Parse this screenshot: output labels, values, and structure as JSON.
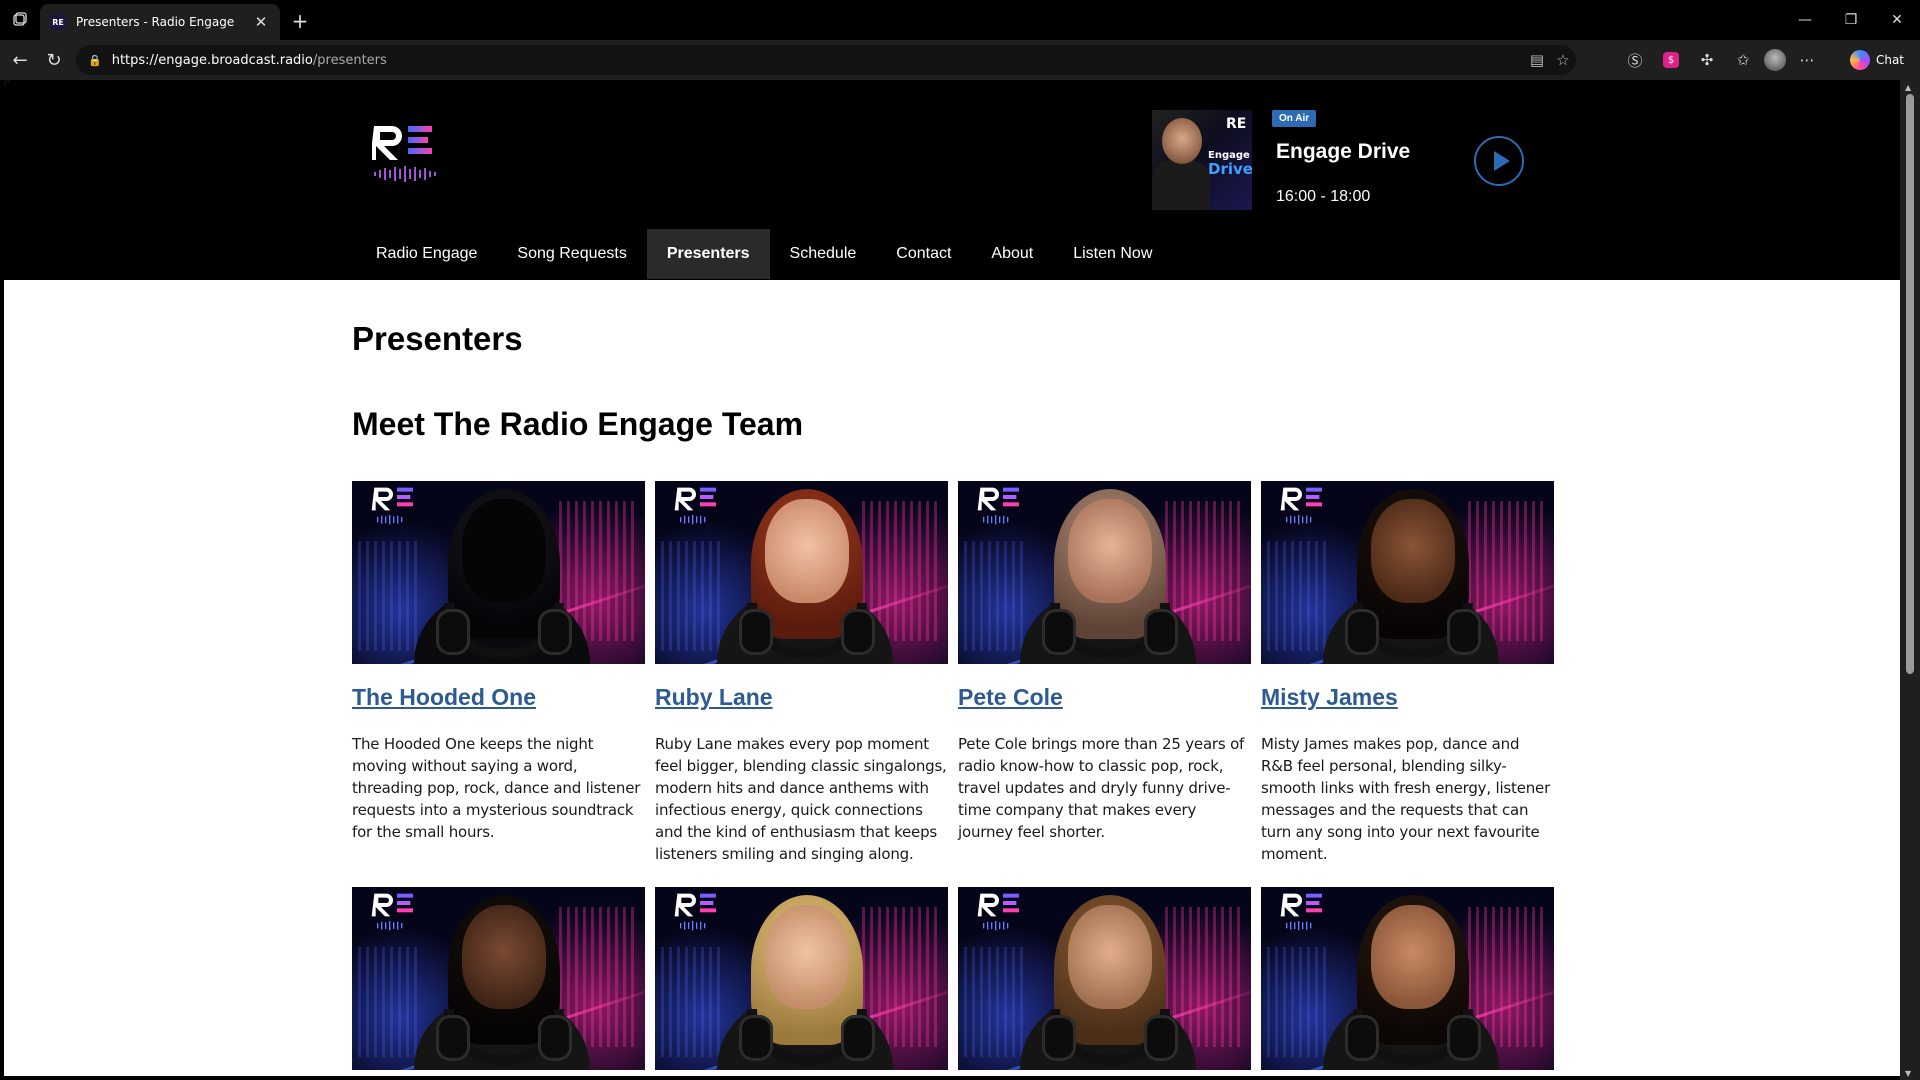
{
  "browser": {
    "tab_title": "Presenters - Radio Engage",
    "favicon_text": "RE",
    "url_host": "https://engage.broadcast.radio",
    "url_path": "/presenters",
    "chat_label": "Chat"
  },
  "site": {
    "logo_text": "RE",
    "now_playing": {
      "badge": "On Air",
      "show": "Engage Drive",
      "time": "16:00 - 18:00",
      "art_text_1": "Engage",
      "art_text_2": "Drive"
    },
    "nav": [
      {
        "label": "Radio Engage",
        "active": false
      },
      {
        "label": "Song Requests",
        "active": false
      },
      {
        "label": "Presenters",
        "active": true
      },
      {
        "label": "Schedule",
        "active": false
      },
      {
        "label": "Contact",
        "active": false
      },
      {
        "label": "About",
        "active": false
      },
      {
        "label": "Listen Now",
        "active": false
      }
    ]
  },
  "page": {
    "title": "Presenters",
    "section_title": "Meet The Radio Engage Team",
    "presenters": [
      {
        "name": "The Hooded One",
        "bio": "The Hooded One keeps the night moving without saying a word, threading pop, rock, dance and listener requests into a mysterious soundtrack for the small hours."
      },
      {
        "name": "Ruby Lane",
        "bio": "Ruby Lane makes every pop moment feel bigger, blending classic singalongs, modern hits and dance anthems with infectious energy, quick connections and the kind of enthusiasm that keeps listeners smiling and singing along."
      },
      {
        "name": "Pete Cole",
        "bio": "Pete Cole brings more than 25 years of radio know-how to classic pop, rock, travel updates and dryly funny drive-time company that makes every journey feel shorter."
      },
      {
        "name": "Misty James",
        "bio": "Misty James makes pop, dance and R&B feel personal, blending silky-smooth links with fresh energy, listener messages and the requests that can turn any song into your next favourite moment."
      },
      {
        "name": "",
        "bio": ""
      },
      {
        "name": "",
        "bio": ""
      },
      {
        "name": "",
        "bio": ""
      },
      {
        "name": "",
        "bio": ""
      }
    ]
  },
  "colors": {
    "accent_blue": "#2d6bb5",
    "link": "#2d5a93",
    "header_bg": "#000000",
    "nav_active_bg": "#2a2a2a"
  }
}
